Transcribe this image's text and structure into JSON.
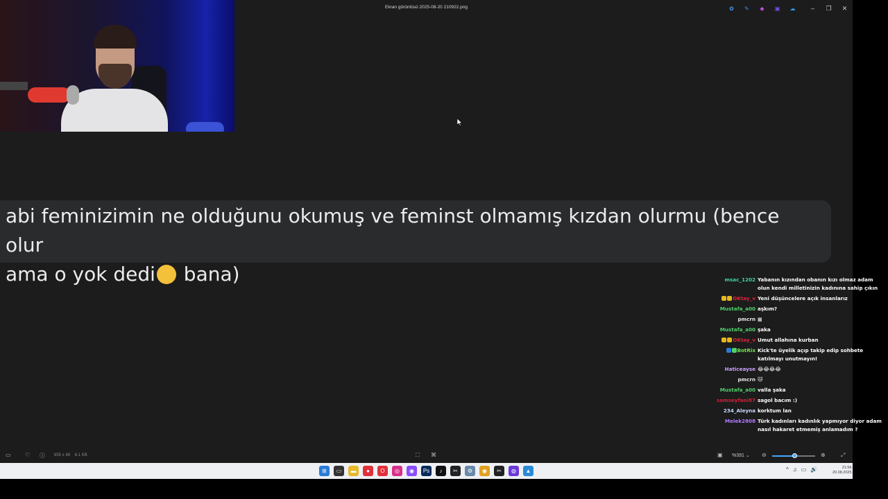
{
  "window": {
    "title": "Ekran görüntüsü 2025-08-20 210922.png",
    "minimize": "–",
    "maximize": "❐",
    "close": "✕"
  },
  "title_icons": [
    {
      "name": "copilot-icon",
      "glyph": "✿",
      "color": "#4aa0ff"
    },
    {
      "name": "edit-icon",
      "glyph": "✎",
      "color": "#3a8fff"
    },
    {
      "name": "paint-icon",
      "glyph": "◆",
      "color": "#c04cd8"
    },
    {
      "name": "clipchamp-icon",
      "glyph": "▣",
      "color": "#7a4cff"
    },
    {
      "name": "onedrive-icon",
      "glyph": "☁",
      "color": "#2aa0ff"
    }
  ],
  "banner": {
    "line1": "abi feminizimin ne olduğunu okumuş ve feminst olmamış kızdan olurmu (bence olur",
    "line2_before": "ama o yok dedi",
    "line2_after": " bana)"
  },
  "chat": [
    {
      "user": "msac_1202",
      "color": "#3fd4a4",
      "text": "Yabanın kızından obanın kızı olmaz adam olun kendi milletinizin kadınına sahip çıkın"
    },
    {
      "user": "OKtay_v",
      "color": "#e0213a",
      "badges": [
        "#e6b820",
        "#e6b820"
      ],
      "text": "Yeni düşüncelere açık insanlarız"
    },
    {
      "user": "Mustafa_a00",
      "color": "#4fd06a",
      "text": "aşkım?"
    },
    {
      "user": "pmcrn",
      "color": "#e8e8e8",
      "text": "▦"
    },
    {
      "user": "Mustafa_a00",
      "color": "#4fd06a",
      "text": "şaka"
    },
    {
      "user": "OKtay_v",
      "color": "#e0213a",
      "badges": [
        "#e6b820",
        "#e6b820"
      ],
      "text": "Umut allahına kurban"
    },
    {
      "user": "BotRix",
      "color": "#6ee84f",
      "badges": [
        "#2a7bd8",
        "#4fd06a"
      ],
      "text": "Kick'te üyelik açıp takip edip sohbete katılmayı unutmayın!"
    },
    {
      "user": "Haticeayse",
      "color": "#c9a0ff",
      "text": "😂😂😂😂"
    },
    {
      "user": "pmcrn",
      "color": "#e8e8e8",
      "text": "🐱"
    },
    {
      "user": "Mustafa_a00",
      "color": "#4fd06a",
      "text": "valla şaka"
    },
    {
      "user": "samseyfani87",
      "color": "#d0203a",
      "text": "sagol bacım :)"
    },
    {
      "user": "234_Aleyna",
      "color": "#c8d8ff",
      "text": "korktum lan"
    },
    {
      "user": "Melek2808",
      "color": "#b07aff",
      "text": "Türk kadınları kadınlık yapmıyor diyor adam nasıl hakaret etmemiş anlamadım ?"
    }
  ],
  "bottombar": {
    "dims": "655 x 48",
    "size": "6.1 KB",
    "zoom": "%391",
    "zoom_level": 0.52
  },
  "taskbar": {
    "apps": [
      {
        "name": "windows-start-icon",
        "glyph": "⊞",
        "color": "#2a7bd8"
      },
      {
        "name": "task-view-icon",
        "glyph": "▭",
        "color": "#333"
      },
      {
        "name": "file-explorer-icon",
        "glyph": "▬",
        "color": "#e8b82a"
      },
      {
        "name": "paint-app-icon",
        "glyph": "●",
        "color": "#e0303a"
      },
      {
        "name": "opera-icon",
        "glyph": "O",
        "color": "#e0303a"
      },
      {
        "name": "instagram-icon",
        "glyph": "◎",
        "color": "#d8308a"
      },
      {
        "name": "messenger-icon",
        "glyph": "◉",
        "color": "#8a4cff"
      },
      {
        "name": "photoshop-icon",
        "glyph": "Ps",
        "color": "#0a2a5a"
      },
      {
        "name": "tiktok-icon",
        "glyph": "♪",
        "color": "#111"
      },
      {
        "name": "capcut-icon",
        "glyph": "✂",
        "color": "#222"
      },
      {
        "name": "settings-icon",
        "glyph": "⚙",
        "color": "#6a8aaa"
      },
      {
        "name": "chrome-icon",
        "glyph": "◉",
        "color": "#e0a020"
      },
      {
        "name": "capcut2-icon",
        "glyph": "✂",
        "color": "#222"
      },
      {
        "name": "obs-icon",
        "glyph": "◍",
        "color": "#6a3ad8"
      },
      {
        "name": "photos-icon",
        "glyph": "▲",
        "color": "#2a8ad8"
      }
    ],
    "tray": [
      "^",
      "♫",
      "▭",
      "🔊"
    ],
    "time": "21:56",
    "date": "20.08.2025"
  }
}
